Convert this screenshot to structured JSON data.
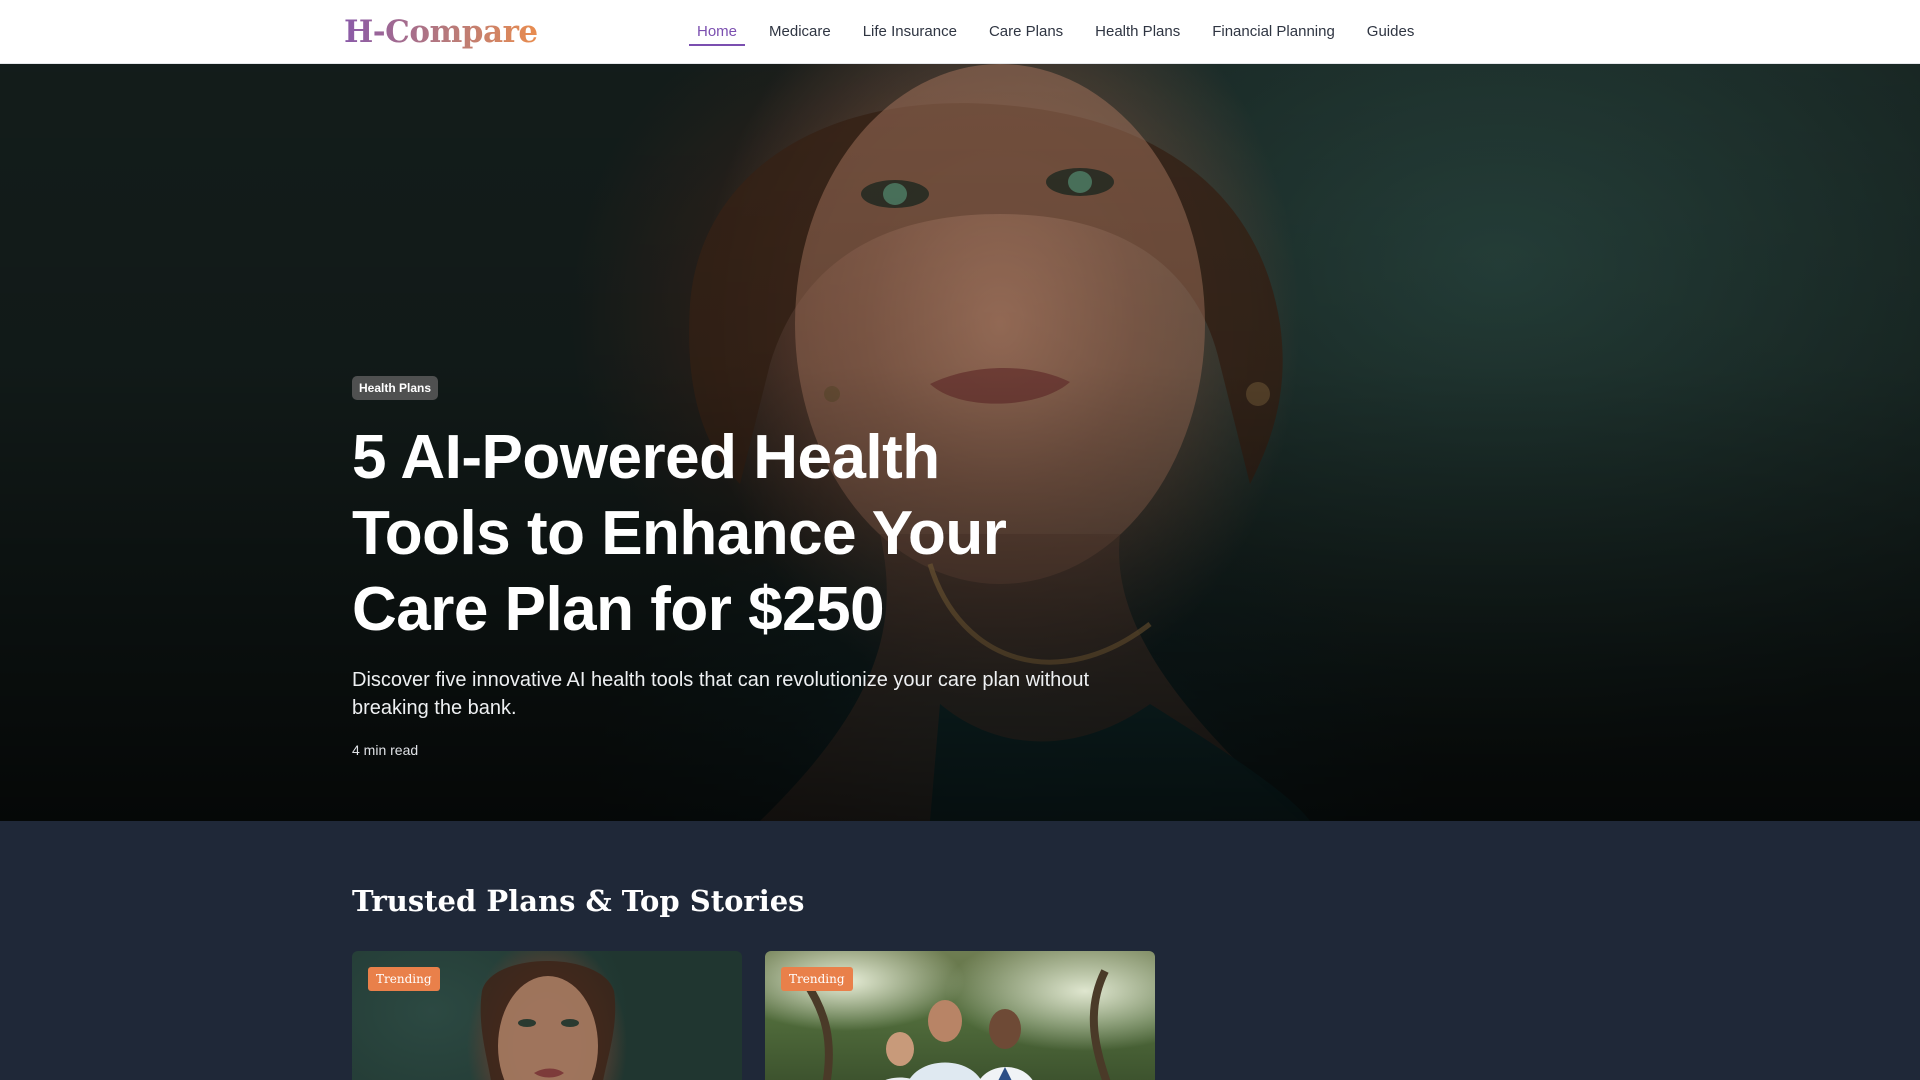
{
  "header": {
    "logo": "H-Compare",
    "nav": [
      {
        "label": "Home",
        "active": true
      },
      {
        "label": "Medicare",
        "active": false
      },
      {
        "label": "Life Insurance",
        "active": false
      },
      {
        "label": "Care Plans",
        "active": false
      },
      {
        "label": "Health Plans",
        "active": false
      },
      {
        "label": "Financial Planning",
        "active": false
      },
      {
        "label": "Guides",
        "active": false
      }
    ]
  },
  "hero": {
    "badge": "Health Plans",
    "title": "5 AI-Powered Health Tools to Enhance Your Care Plan for $250",
    "subtitle": "Discover five innovative AI health tools that can revolutionize your care plan without breaking the bank.",
    "meta": "4 min read"
  },
  "stories": {
    "heading": "Trusted Plans & Top Stories",
    "cards": [
      {
        "badge": "Trending"
      },
      {
        "badge": "Trending"
      }
    ]
  },
  "colors": {
    "accent": "#7b4fb0",
    "trending_badge": "#e9804a",
    "stories_bg": "#1f2838"
  }
}
